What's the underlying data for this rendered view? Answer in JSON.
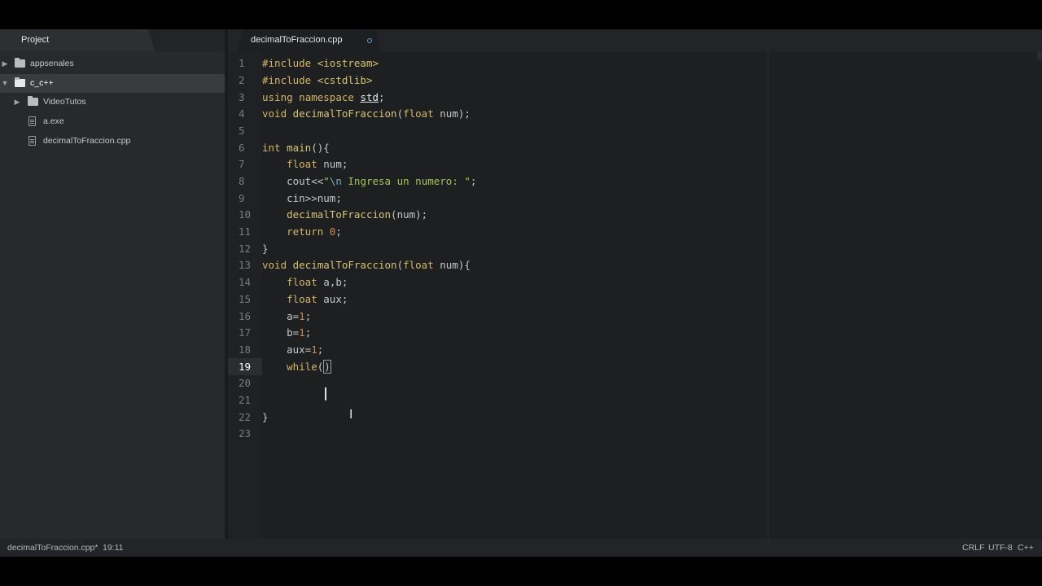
{
  "sidebar": {
    "tab_title": "Project",
    "items": [
      {
        "label": "appsenales",
        "type": "folder",
        "expanded": false
      },
      {
        "label": "c_c++",
        "type": "folder",
        "expanded": true
      },
      {
        "label": "VideoTutos",
        "type": "folder",
        "expanded": false
      },
      {
        "label": "a.exe",
        "type": "file"
      },
      {
        "label": "decimalToFraccion.cpp",
        "type": "file"
      }
    ]
  },
  "editor": {
    "tab_title": "decimalToFraccion.cpp",
    "line_numbers": [
      "1",
      "2",
      "3",
      "4",
      "5",
      "6",
      "7",
      "8",
      "9",
      "10",
      "11",
      "12",
      "13",
      "14",
      "15",
      "16",
      "17",
      "18",
      "19",
      "20",
      "21",
      "22",
      "23"
    ],
    "active_line": "19",
    "code": [
      "#include <iostream>",
      "#include <cstdlib>",
      "using namespace std;",
      "void decimalToFraccion(float num);",
      "",
      "int main(){",
      "    float num;",
      "    cout<<\"\\n Ingresa un numero: \";",
      "    cin>>num;",
      "    decimalToFraccion(num);",
      "    return 0;",
      "}",
      "void decimalToFraccion(float num){",
      "    float a,b;",
      "    float aux;",
      "    a=1;",
      "    b=1;",
      "    aux=1;",
      "    while()",
      "",
      "",
      "}",
      ""
    ]
  },
  "status": {
    "file": "decimalToFraccion.cpp*",
    "cursor": "19:11",
    "line_ending": "CRLF",
    "encoding": "UTF-8",
    "grammar": "C++"
  },
  "colors": {
    "background": "#1e1f21",
    "sidebar": "#28292c",
    "modified_dot": "#5aa0e6"
  }
}
